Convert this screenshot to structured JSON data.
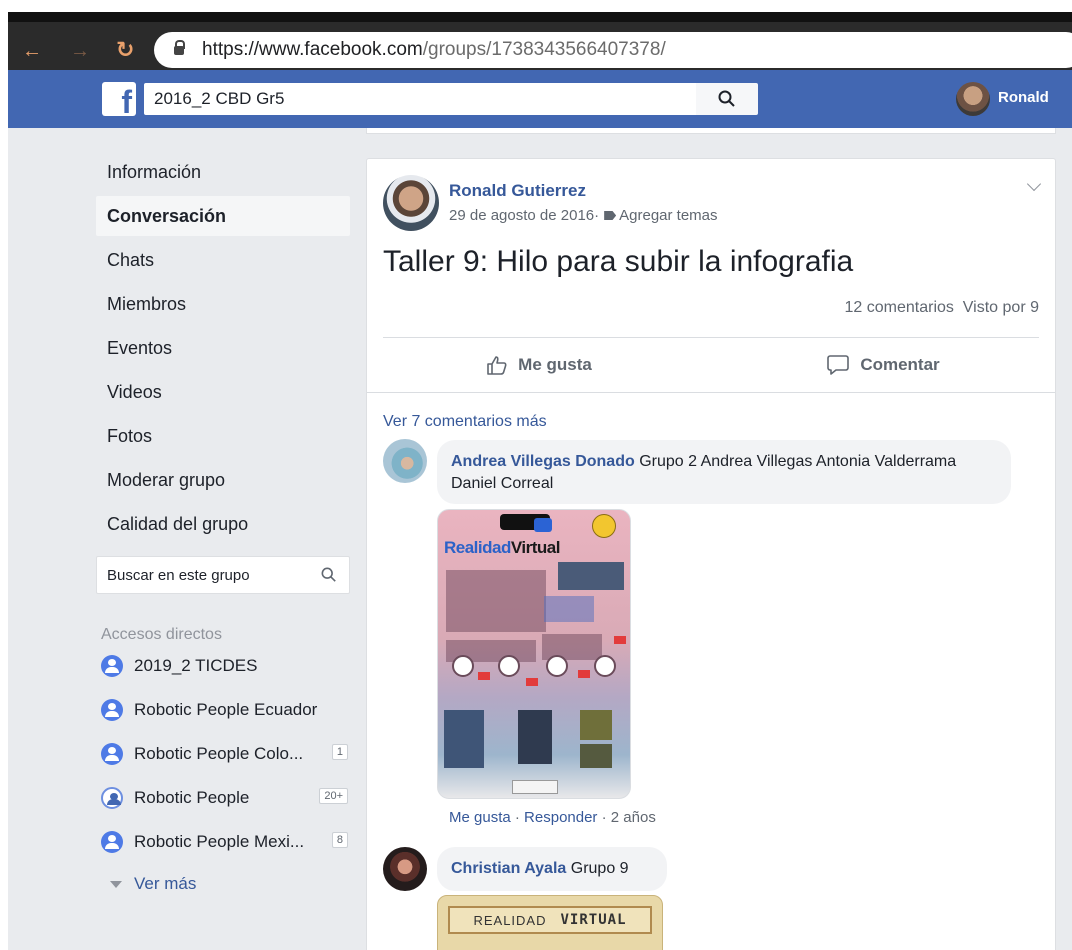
{
  "browser": {
    "url_host": "https://www.facebook.com",
    "url_path": "/groups/1738343566407378/"
  },
  "fb_header": {
    "logo": "f",
    "search_value": "2016_2 CBD Gr5",
    "user_name": "Ronald"
  },
  "sidebar": {
    "items": [
      {
        "label": "Información"
      },
      {
        "label": "Conversación",
        "active": true
      },
      {
        "label": "Chats"
      },
      {
        "label": "Miembros"
      },
      {
        "label": "Eventos"
      },
      {
        "label": "Videos"
      },
      {
        "label": "Fotos"
      },
      {
        "label": "Moderar grupo"
      },
      {
        "label": "Calidad del grupo"
      }
    ],
    "group_search_placeholder": "Buscar en este grupo",
    "shortcuts_title": "Accesos directos",
    "shortcuts": [
      {
        "label": "2019_2 TICDES",
        "badge": ""
      },
      {
        "label": "Robotic People Ecuador",
        "badge": ""
      },
      {
        "label": "Robotic People Colo...",
        "badge": "1"
      },
      {
        "label": "Robotic People",
        "badge": "20+"
      },
      {
        "label": "Robotic People Mexi...",
        "badge": "8"
      }
    ],
    "see_more": "Ver más"
  },
  "post": {
    "author": "Ronald Gutierrez",
    "date": "29 de agosto de 2016",
    "separator": " · ",
    "add_topics": "Agregar temas",
    "title": "Taller 9: Hilo para subir la infografia",
    "comments_count": "12 comentarios",
    "seen_by": "Visto por 9",
    "like_label": "Me gusta",
    "comment_label": "Comentar",
    "more_comments": "Ver 7 comentarios más"
  },
  "comments": [
    {
      "author": "Andrea Villegas Donado",
      "text": " Grupo 2 Andrea Villegas Antonia Valderrama Daniel Correal",
      "image_title_a": "Realidad",
      "image_title_b": "Virtual",
      "like": "Me gusta",
      "reply": "Responder",
      "age": "2 años"
    },
    {
      "author": "Christian Ayala",
      "text": " Grupo 9",
      "image_title_a": "REALIDAD",
      "image_title_b": "VIRTUAL"
    }
  ],
  "icons": {
    "browser": [
      "back-arrow-icon",
      "forward-arrow-icon",
      "reload-icon",
      "lock-icon"
    ],
    "header": [
      "facebook-logo",
      "search-icon"
    ],
    "post": [
      "chevron-down-icon",
      "tag-icon",
      "thumbs-up-icon",
      "comment-icon"
    ]
  },
  "colors": {
    "fb_blue": "#4267b2",
    "link_blue": "#365899",
    "page_bg": "#e9ebee"
  }
}
